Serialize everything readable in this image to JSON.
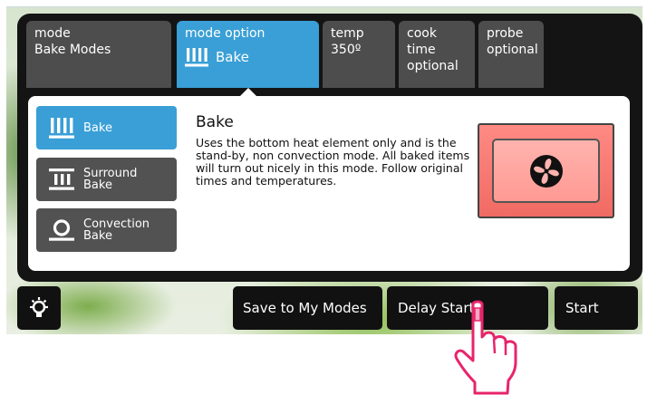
{
  "tabs": {
    "mode": {
      "label": "mode",
      "value": "Bake Modes"
    },
    "mode_option": {
      "label": "mode option",
      "value": "Bake"
    },
    "temp": {
      "label": "temp",
      "value": "350º"
    },
    "cook_time": {
      "label": "cook time",
      "value": "optional"
    },
    "probe": {
      "label": "probe",
      "value": "optional"
    }
  },
  "mode_options": [
    {
      "label_line1": "Bake",
      "label_line2": "",
      "icon": "bake-icon",
      "selected": true
    },
    {
      "label_line1": "Surround",
      "label_line2": "Bake",
      "icon": "surround-bake-icon",
      "selected": false
    },
    {
      "label_line1": "Convection",
      "label_line2": "Bake",
      "icon": "convection-bake-icon",
      "selected": false
    }
  ],
  "description": {
    "title": "Bake",
    "text": "Uses the bottom heat element only and is the stand-by, non convection mode. All baked items will turn out nicely in this mode. Follow original times and temperatures."
  },
  "illustration": {
    "icon": "fan-icon"
  },
  "bottom_bar": {
    "light_icon": "light-bulb-icon",
    "save_label": "Save to My Modes",
    "delay_label": "Delay Start",
    "start_label": "Start"
  },
  "colors": {
    "accent_blue": "#3a9fd6",
    "tab_gray": "#4d4d4d",
    "panel_dark": "#141414",
    "oven_red": "#f06a63",
    "pointer_pink": "#e8246b"
  }
}
